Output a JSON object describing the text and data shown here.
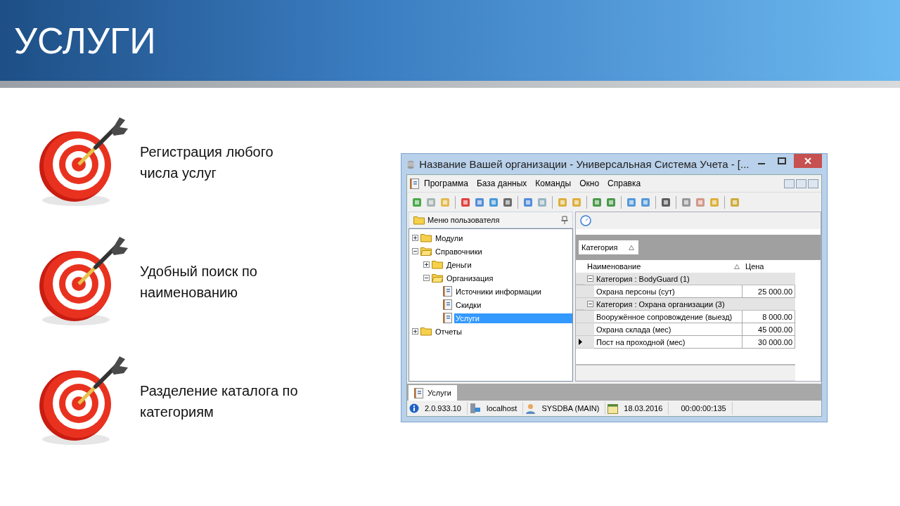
{
  "slide": {
    "title": "УСЛУГИ",
    "features": [
      {
        "lines": [
          "Регистрация любого",
          "числа услуг"
        ]
      },
      {
        "lines": [
          "Удобный поиск по",
          "наименованию"
        ]
      },
      {
        "lines": [
          "Разделение каталога по",
          "категориям"
        ]
      }
    ]
  },
  "window": {
    "title": "Название Вашей организации - Универсальная Система Учета - [...",
    "menu": [
      "Программа",
      "База данных",
      "Команды",
      "Окно",
      "Справка"
    ],
    "left_panel": {
      "title": "Меню пользователя",
      "tree": [
        {
          "label": "Модули",
          "kind": "folder",
          "expanded": false,
          "selected": false
        },
        {
          "label": "Справочники",
          "kind": "folder",
          "expanded": true,
          "selected": false,
          "children": [
            {
              "label": "Деньги",
              "kind": "folder",
              "expanded": false,
              "selected": false
            },
            {
              "label": "Организация",
              "kind": "folder",
              "expanded": true,
              "selected": false,
              "children": [
                {
                  "label": "Источники информации",
                  "kind": "document",
                  "selected": false
                },
                {
                  "label": "Скидки",
                  "kind": "document",
                  "selected": false
                },
                {
                  "label": "Услуги",
                  "kind": "document",
                  "selected": true
                }
              ]
            }
          ]
        },
        {
          "label": "Отчеты",
          "kind": "folder",
          "expanded": false,
          "selected": false
        }
      ]
    },
    "grid": {
      "group_by": "Категория",
      "columns": [
        "Наименование",
        "Цена"
      ],
      "groups": [
        {
          "label": "Категория : BodyGuard (1)",
          "expanded": true,
          "rows": [
            {
              "name": "Охрана персоны (сут)",
              "price": "25 000.00",
              "selected": false
            }
          ]
        },
        {
          "label": "Категория : Охрана организации (3)",
          "expanded": true,
          "rows": [
            {
              "name": "Вооружённое сопровождение (выезд)",
              "price": "8 000.00",
              "selected": false
            },
            {
              "name": "Охрана склада (мес)",
              "price": "45 000.00",
              "selected": false
            },
            {
              "name": "Пост на проходной (мес)",
              "price": "30 000.00",
              "selected": true
            }
          ]
        }
      ]
    },
    "tabs": [
      {
        "label": "Услуги",
        "selected": true
      }
    ],
    "status_bar": [
      {
        "kind": "info",
        "text": "2.0.933.10"
      },
      {
        "kind": "server",
        "text": "localhost"
      },
      {
        "kind": "user",
        "text": "SYSDBA (MAIN)"
      },
      {
        "kind": "date",
        "text": "18.03.2016"
      },
      {
        "kind": "time",
        "text": "00:00:00:135"
      }
    ]
  }
}
